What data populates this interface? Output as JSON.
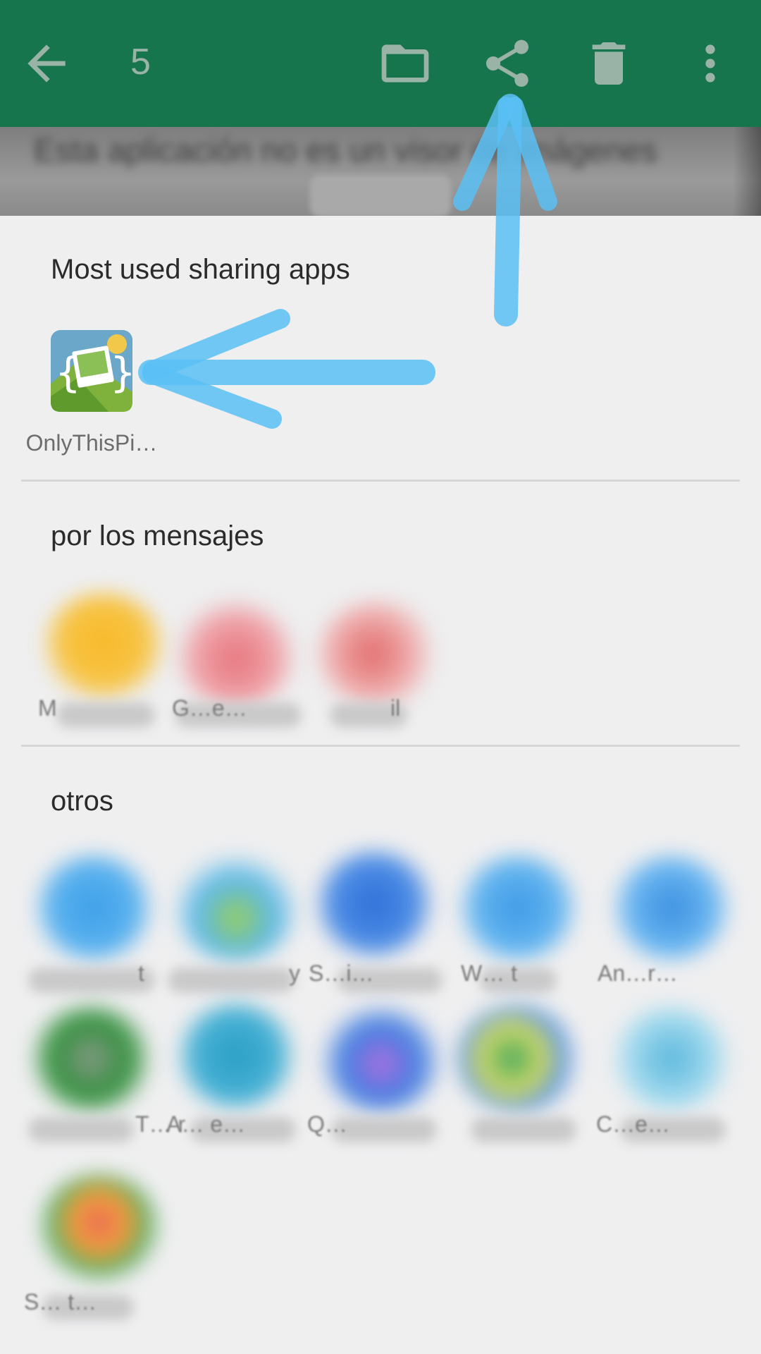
{
  "toolbar": {
    "back_icon": "arrow-back-icon",
    "selection_count": "5",
    "folder_icon": "folder-icon",
    "share_icon": "share-icon",
    "delete_icon": "trash-icon",
    "more_icon": "more-vert-icon",
    "background": "#17754d",
    "icon_color": "#9ab3a7"
  },
  "underlying": {
    "text": "Esta aplicación no es un visor de imágenes"
  },
  "share_sheet": {
    "most_used": {
      "title": "Most used sharing apps",
      "apps": [
        {
          "label": "OnlyThisPi…",
          "icon": "gallery-app-icon"
        }
      ]
    },
    "messages": {
      "title": "por los mensajes",
      "apps": [
        {
          "label": "M",
          "icon": "messaging-app-icon"
        },
        {
          "label": "G…e…",
          "icon": "mail-app-icon"
        },
        {
          "label": "il",
          "icon": "gmail-icon"
        }
      ]
    },
    "others": {
      "title": "otros",
      "apps": [
        {
          "label": "t",
          "icon": "blurred-app-icon"
        },
        {
          "label": "y",
          "icon": "blurred-app-icon"
        },
        {
          "label": "S…i…",
          "icon": "blurred-app-icon"
        },
        {
          "label": "W… t",
          "icon": "blurred-app-icon"
        },
        {
          "label": "An…r…",
          "icon": "blurred-app-icon"
        },
        {
          "label": "T… r",
          "icon": "blurred-app-icon"
        },
        {
          "label": "A… e…",
          "icon": "blurred-app-icon"
        },
        {
          "label": "Q…",
          "icon": "blurred-app-icon"
        },
        {
          "label": "",
          "icon": "blurred-app-icon"
        },
        {
          "label": "C…e…",
          "icon": "blurred-app-icon"
        },
        {
          "label": "S… t…",
          "icon": "blurred-app-icon"
        }
      ]
    }
  },
  "annotations": {
    "arrow_color": "#5bc0f5"
  }
}
